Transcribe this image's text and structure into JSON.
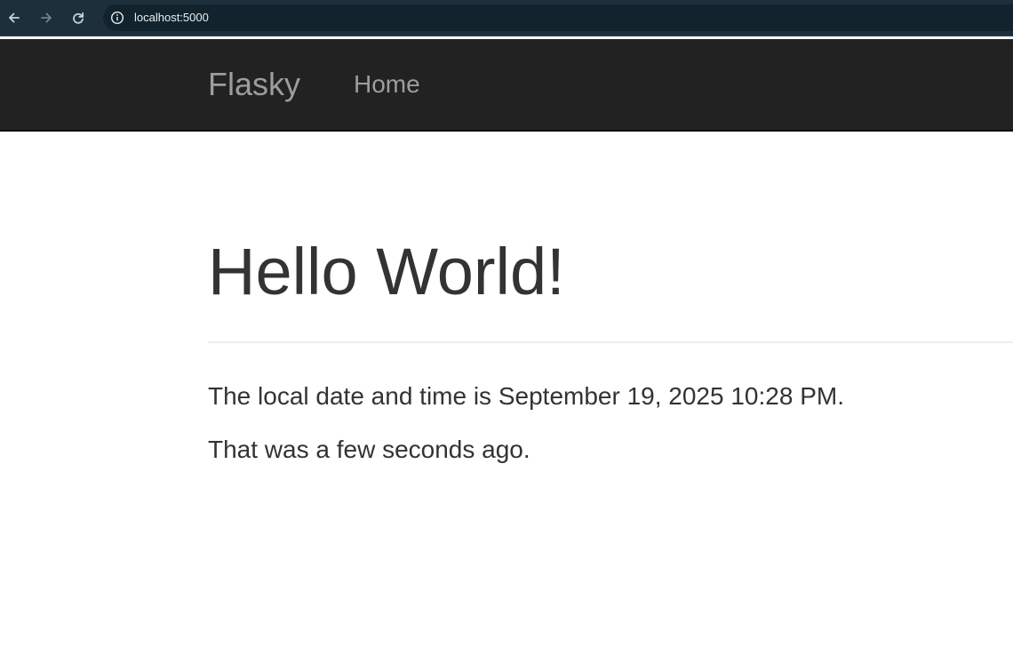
{
  "browser": {
    "url": "localhost:5000"
  },
  "navbar": {
    "brand": "Flasky",
    "links": [
      {
        "label": "Home"
      }
    ]
  },
  "content": {
    "heading": "Hello World!",
    "datetime_text": "The local date and time is September 19, 2025 10:28 PM.",
    "relative_text": "That was a few seconds ago."
  }
}
